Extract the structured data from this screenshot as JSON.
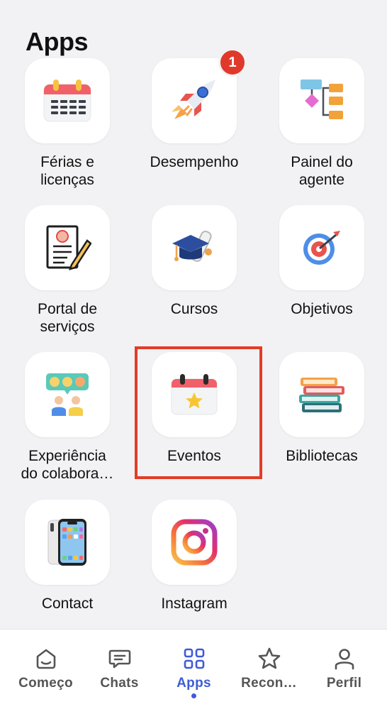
{
  "page": {
    "title": "Apps"
  },
  "apps": [
    {
      "id": "ferias",
      "label": "Férias e\nlicenças",
      "icon": "calendar-icon"
    },
    {
      "id": "desempenho",
      "label": "Desempenho",
      "icon": "rocket-icon",
      "badge": "1"
    },
    {
      "id": "painel",
      "label": "Painel  do\nagente",
      "icon": "flowchart-icon"
    },
    {
      "id": "portal",
      "label": "Portal de\nserviços",
      "icon": "document-pencil-icon"
    },
    {
      "id": "cursos",
      "label": "Cursos",
      "icon": "graduation-cap-icon"
    },
    {
      "id": "objetivos",
      "label": "Objetivos",
      "icon": "target-icon"
    },
    {
      "id": "experiencia",
      "label": "Experiência\ndo  colabora…",
      "icon": "feedback-people-icon"
    },
    {
      "id": "eventos",
      "label": "Eventos",
      "icon": "star-calendar-icon"
    },
    {
      "id": "bibliotecas",
      "label": "Bibliotecas",
      "icon": "books-icon"
    },
    {
      "id": "contact",
      "label": "Contact",
      "icon": "phone-icon"
    },
    {
      "id": "instagram",
      "label": "Instagram",
      "icon": "instagram-icon"
    }
  ],
  "tabbar": {
    "tabs": [
      {
        "label": "Começo",
        "icon": "home-icon"
      },
      {
        "label": "Chats",
        "icon": "chat-icon"
      },
      {
        "label": "Apps",
        "icon": "apps-grid-icon",
        "active": true
      },
      {
        "label": "Recon…",
        "icon": "star-icon"
      },
      {
        "label": "Perfil",
        "icon": "person-icon"
      }
    ]
  },
  "colors": {
    "accent": "#3f5bd6",
    "badge": "#e0392b",
    "highlight": "#e33c26",
    "background": "#f2f2f4"
  }
}
